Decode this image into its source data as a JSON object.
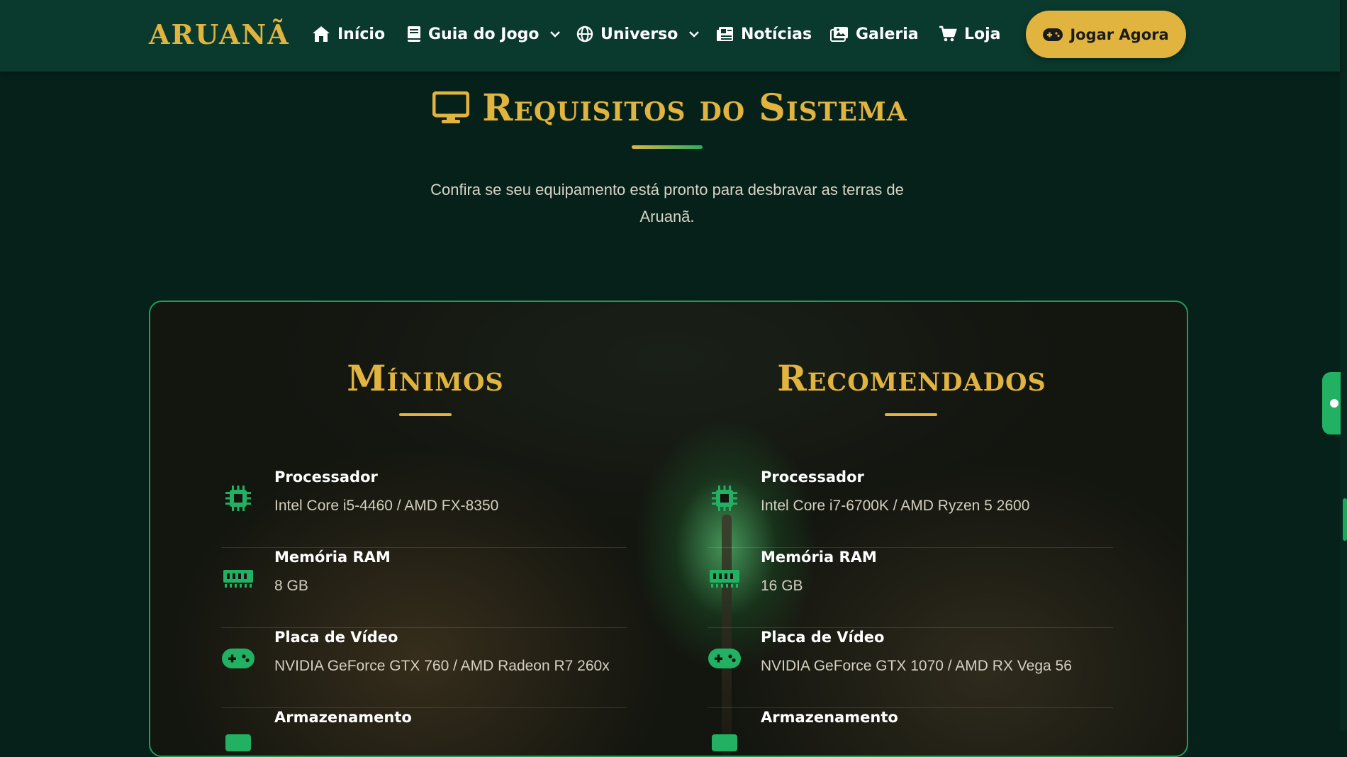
{
  "nav": {
    "logo": "ARUANÃ",
    "items": [
      {
        "label": "Início",
        "icon": "home-icon"
      },
      {
        "label": "Guia do Jogo",
        "icon": "book-icon",
        "dropdown": true
      },
      {
        "label": "Universo",
        "icon": "globe-icon",
        "dropdown": true
      },
      {
        "label": "Notícias",
        "icon": "newspaper-icon"
      },
      {
        "label": "Galeria",
        "icon": "images-icon"
      },
      {
        "label": "Loja",
        "icon": "cart-icon"
      }
    ],
    "cta": {
      "label": "Jogar Agora",
      "icon": "gamepad-icon"
    }
  },
  "section": {
    "title": "Requisitos do Sistema",
    "icon": "desktop-icon",
    "subtitle": "Confira se seu equipamento está pronto para desbravar as terras de Aruanã."
  },
  "minimum": {
    "title": "Mínimos",
    "specs": [
      {
        "label": "Processador",
        "value": "Intel Core i5-4460 / AMD FX-8350",
        "icon": "microchip-icon"
      },
      {
        "label": "Memória RAM",
        "value": "8 GB",
        "icon": "memory-icon"
      },
      {
        "label": "Placa de Vídeo",
        "value": "NVIDIA GeForce GTX 760 / AMD Radeon R7 260x",
        "icon": "gamepad-icon"
      },
      {
        "label": "Armazenamento",
        "value": "",
        "icon": "storage-icon"
      }
    ]
  },
  "recommended": {
    "title": "Recomendados",
    "specs": [
      {
        "label": "Processador",
        "value": "Intel Core i7-6700K / AMD Ryzen 5 2600",
        "icon": "microchip-icon"
      },
      {
        "label": "Memória RAM",
        "value": "16 GB",
        "icon": "memory-icon"
      },
      {
        "label": "Placa de Vídeo",
        "value": "NVIDIA GeForce GTX 1070 / AMD RX Vega 56",
        "icon": "gamepad-icon"
      },
      {
        "label": "Armazenamento",
        "value": "",
        "icon": "storage-icon"
      }
    ]
  },
  "colors": {
    "gold": "#e0b43f",
    "green": "#22b063",
    "navbar": "#0a3a2d",
    "background": "#05211a"
  }
}
